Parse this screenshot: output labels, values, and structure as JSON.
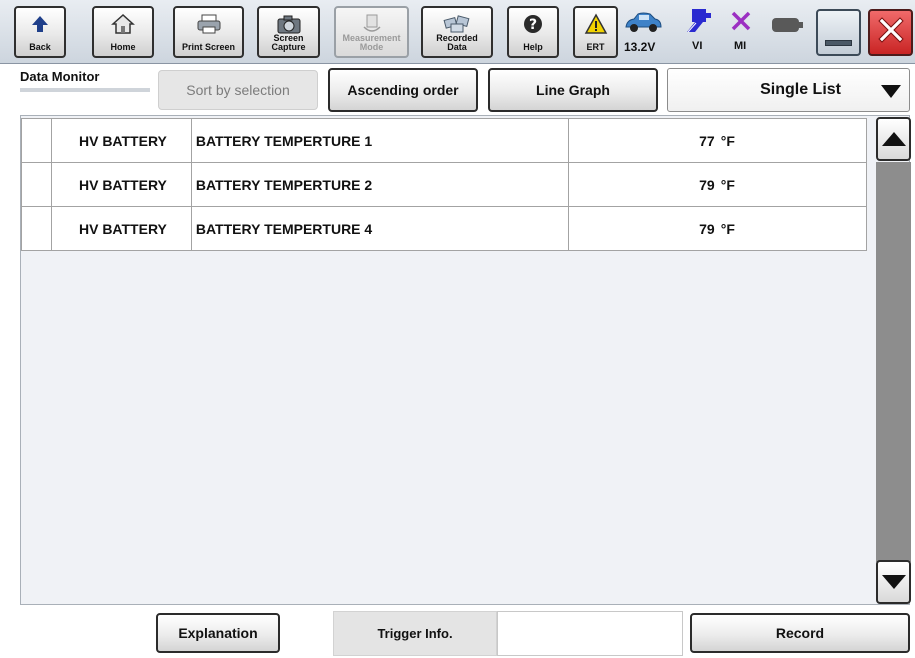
{
  "toolbar": {
    "back": "Back",
    "home": "Home",
    "print_screen": "Print Screen",
    "screen_capture": [
      "Screen",
      "Capture"
    ],
    "measurement_mode": [
      "Measurement",
      "Mode"
    ],
    "recorded_data": [
      "Recorded",
      "Data"
    ],
    "help": "Help",
    "ert": "ERT",
    "battery_voltage": "13.2V",
    "vi": "VI",
    "mi": "MI"
  },
  "controls": {
    "title": "Data Monitor",
    "sort_by_selection": "Sort by selection",
    "ascending_order": "Ascending order",
    "line_graph": "Line Graph",
    "display_mode": "Single List"
  },
  "table": {
    "rows": [
      {
        "system": "HV BATTERY",
        "item": "BATTERY TEMPERTURE 1",
        "value": "77",
        "unit": "°F"
      },
      {
        "system": "HV BATTERY",
        "item": "BATTERY TEMPERTURE 2",
        "value": "79",
        "unit": "°F"
      },
      {
        "system": "HV BATTERY",
        "item": "BATTERY TEMPERTURE 4",
        "value": "79",
        "unit": "°F"
      }
    ]
  },
  "footer": {
    "explanation": "Explanation",
    "trigger_info": "Trigger Info.",
    "trigger_value": "",
    "record": "Record"
  },
  "colors": {
    "close_red": "#d93232",
    "vi_blue": "#2a2ad0",
    "mi_purple": "#9b2fc2",
    "car_blue": "#3e82c8",
    "warning_yellow": "#f2d300"
  }
}
